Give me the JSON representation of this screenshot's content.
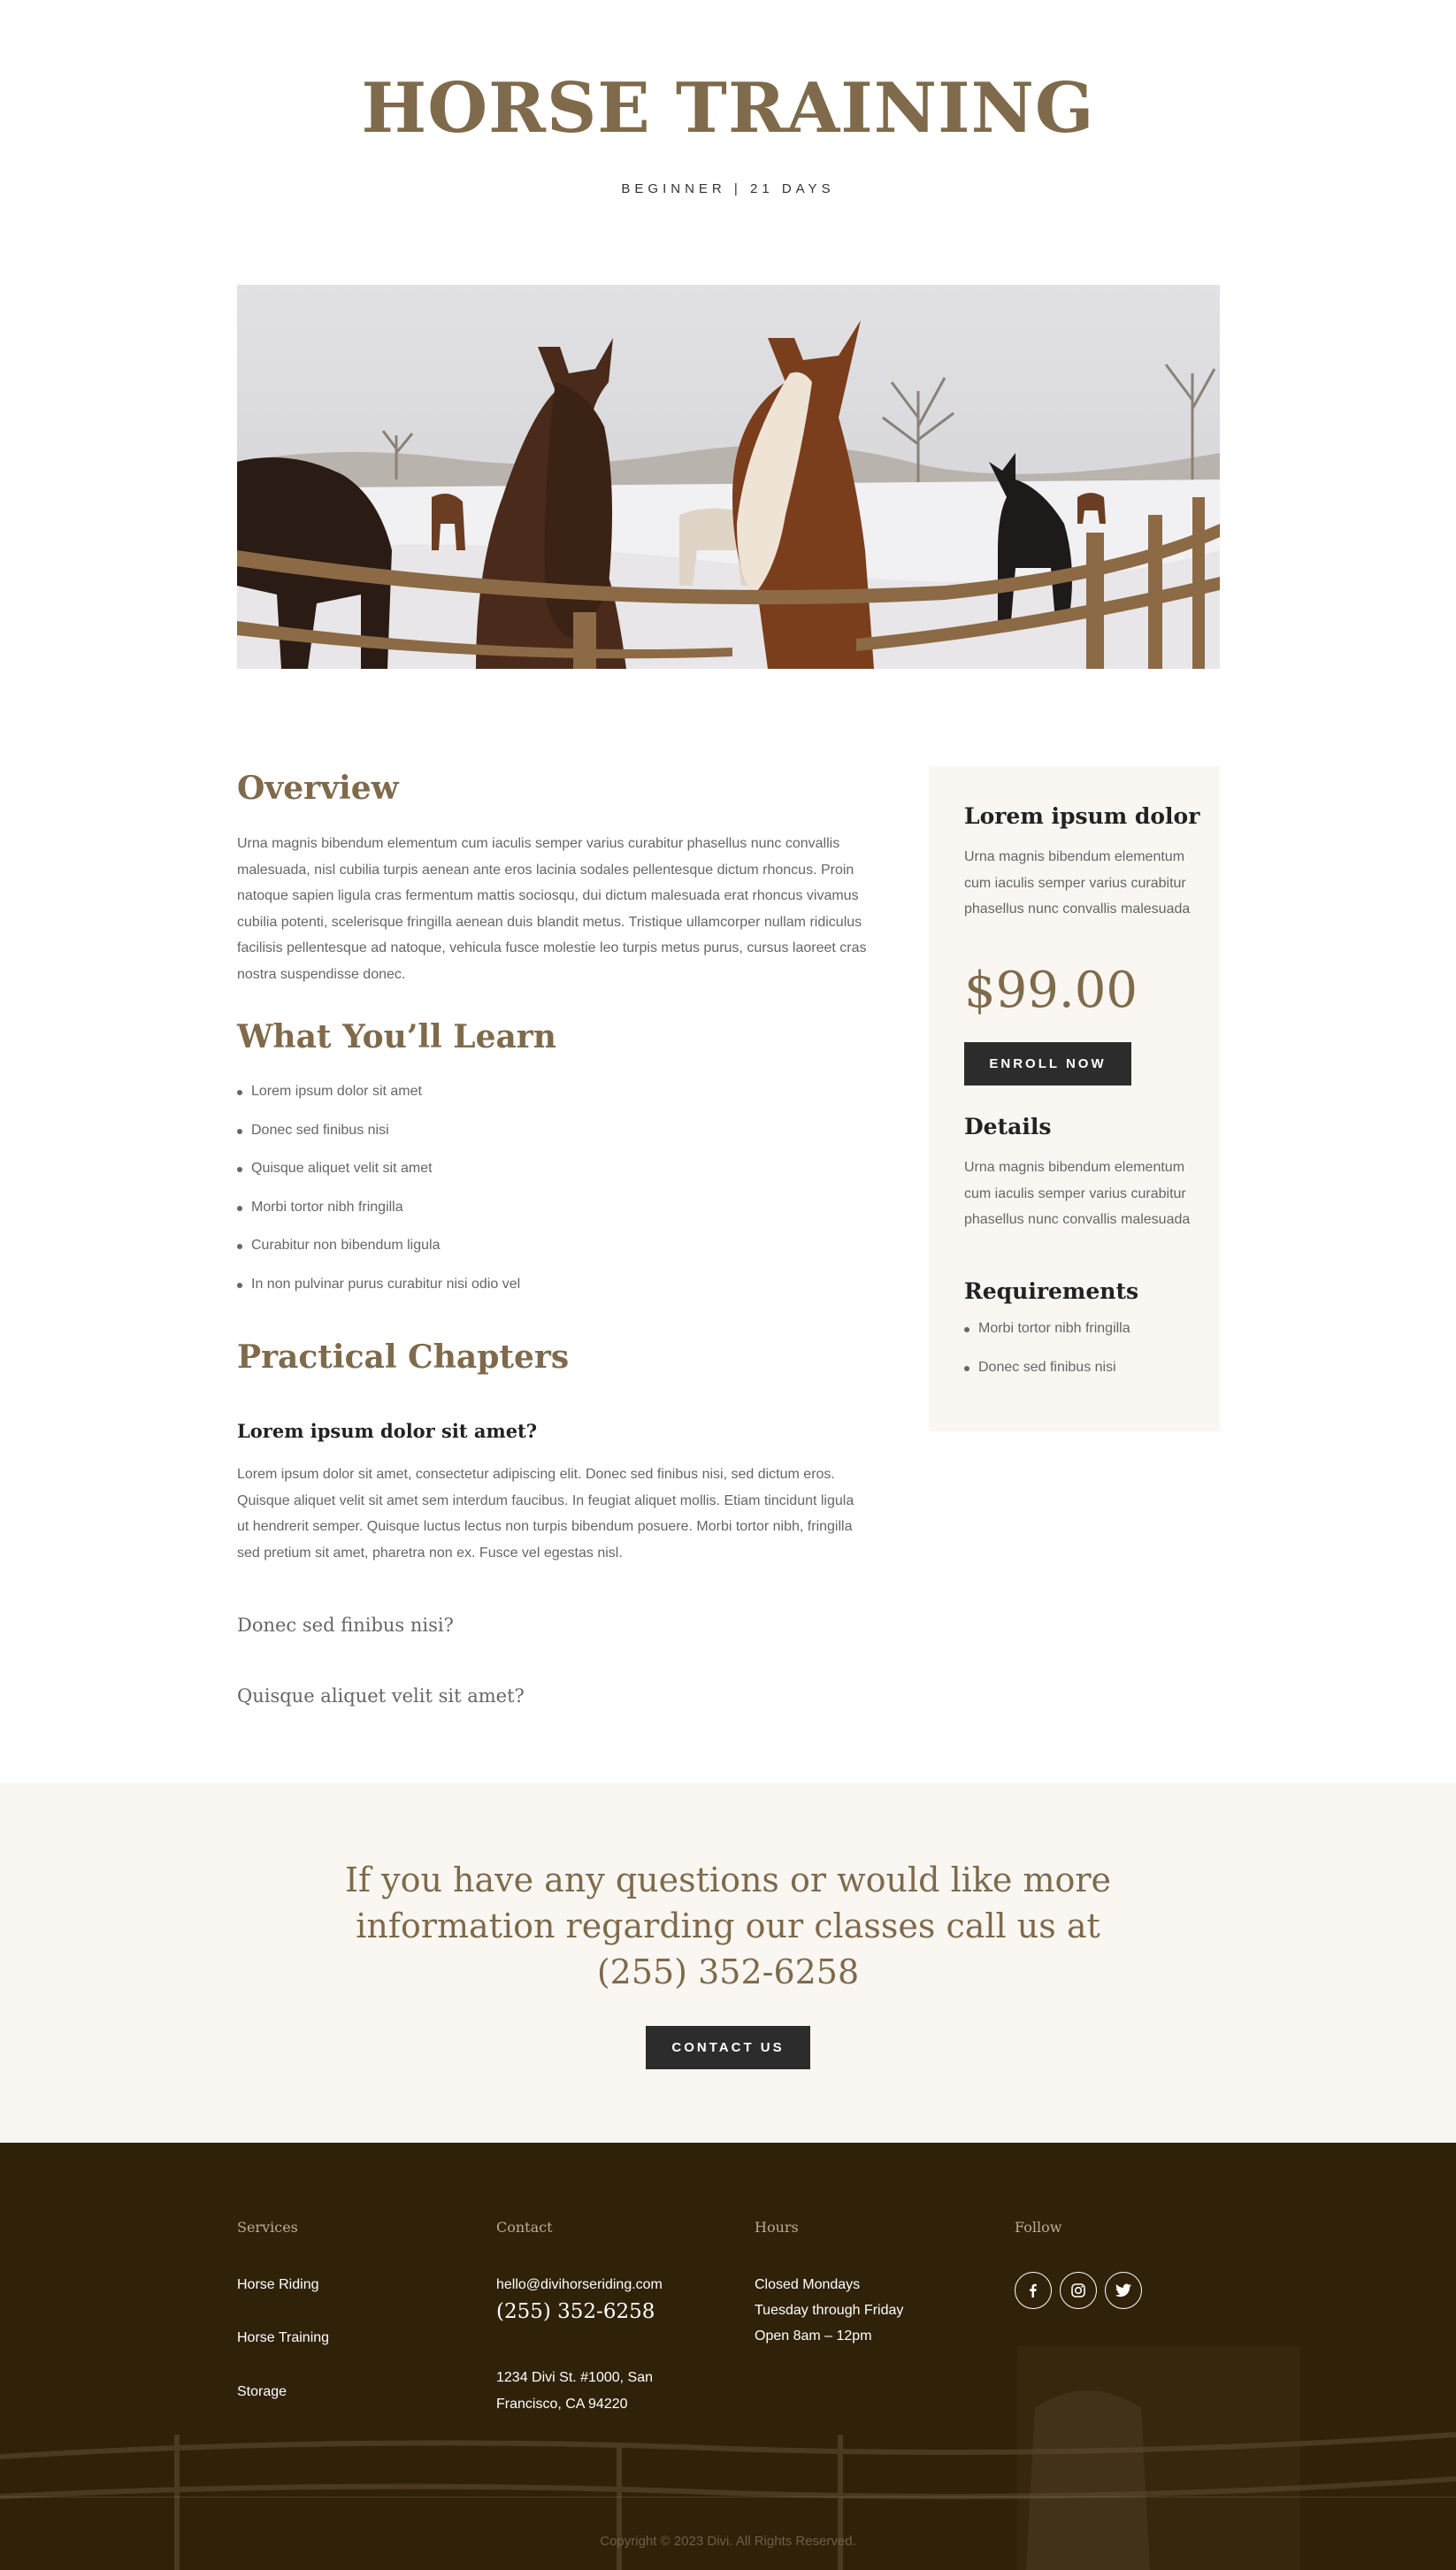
{
  "hero": {
    "title": "HORSE TRAINING",
    "subtitle": "BEGINNER | 21 DAYS",
    "image_alt": "horses-at-fence-photo"
  },
  "overview": {
    "heading": "Overview",
    "text": "Urna magnis bibendum elementum cum iaculis semper varius curabitur phasellus nunc convallis malesuada, nisl cubilia turpis aenean ante eros lacinia sodales pellentesque dictum rhoncus. Proin natoque sapien ligula cras fermentum mattis sociosqu, dui dictum malesuada erat rhoncus vivamus cubilia potenti, scelerisque fringilla aenean duis blandit metus. Tristique ullamcorper nullam ridiculus facilisis pellentesque ad natoque, vehicula fusce molestie leo turpis metus purus, cursus laoreet cras nostra suspendisse donec."
  },
  "learn": {
    "heading": "What You’ll Learn",
    "items": [
      "Lorem ipsum dolor sit amet",
      "Donec sed finibus nisi",
      "Quisque aliquet velit sit amet",
      "Morbi tortor nibh fringilla",
      "Curabitur non bibendum ligula",
      "In non pulvinar purus curabitur nisi odio vel"
    ]
  },
  "chapters": {
    "heading": "Practical Chapters",
    "open_title": "Lorem ipsum dolor sit amet?",
    "open_text": "Lorem ipsum dolor sit amet, consectetur adipiscing elit. Donec sed finibus nisi, sed dictum eros. Quisque aliquet velit sit amet sem interdum faucibus. In feugiat aliquet mollis. Etiam tincidunt ligula ut hendrerit semper. Quisque luctus lectus non turpis bibendum posuere. Morbi tortor nibh, fringilla sed pretium sit amet, pharetra non ex. Fusce vel egestas nisl.",
    "closed": [
      "Donec sed finibus nisi?",
      "Quisque aliquet velit sit amet?"
    ]
  },
  "sidebar": {
    "intro_heading": "Lorem ipsum dolor",
    "intro_text": "Urna magnis bibendum elementum cum iaculis semper varius curabitur phasellus nunc convallis malesuada",
    "price": "$99.00",
    "enroll_label": "ENROLL NOW",
    "details_heading": "Details",
    "details_text": "Urna magnis bibendum elementum cum iaculis semper varius curabitur phasellus nunc convallis malesuada",
    "requirements_heading": "Requirements",
    "requirements": [
      "Morbi tortor nibh fringilla",
      "Donec sed finibus nisi"
    ]
  },
  "cta": {
    "text": "If you have any questions or would like more information regarding our classes call us at (255) 352-6258",
    "button_label": "CONTACT US"
  },
  "footer": {
    "services_title": "Services",
    "services": [
      "Horse Riding",
      "Horse Training",
      "Storage"
    ],
    "contact_title": "Contact",
    "email": "hello@divihorseriding.com",
    "phone": "(255) 352-6258",
    "address": "1234 Divi St. #1000, San Francisco, CA 94220",
    "hours_title": "Hours",
    "hours": [
      "Closed Mondays",
      "Tuesday through Friday",
      "Open 8am – 12pm"
    ],
    "follow_title": "Follow",
    "social": [
      "facebook-icon",
      "instagram-icon",
      "twitter-icon"
    ],
    "copyright": "Copyright © 2023 Divi. All Rights Reserved."
  },
  "colors": {
    "accent_brown": "#7f6a4b",
    "dark_button": "#2c2c2c",
    "cream_bg": "#faf7f3",
    "footer_bg": "#2f2209"
  }
}
